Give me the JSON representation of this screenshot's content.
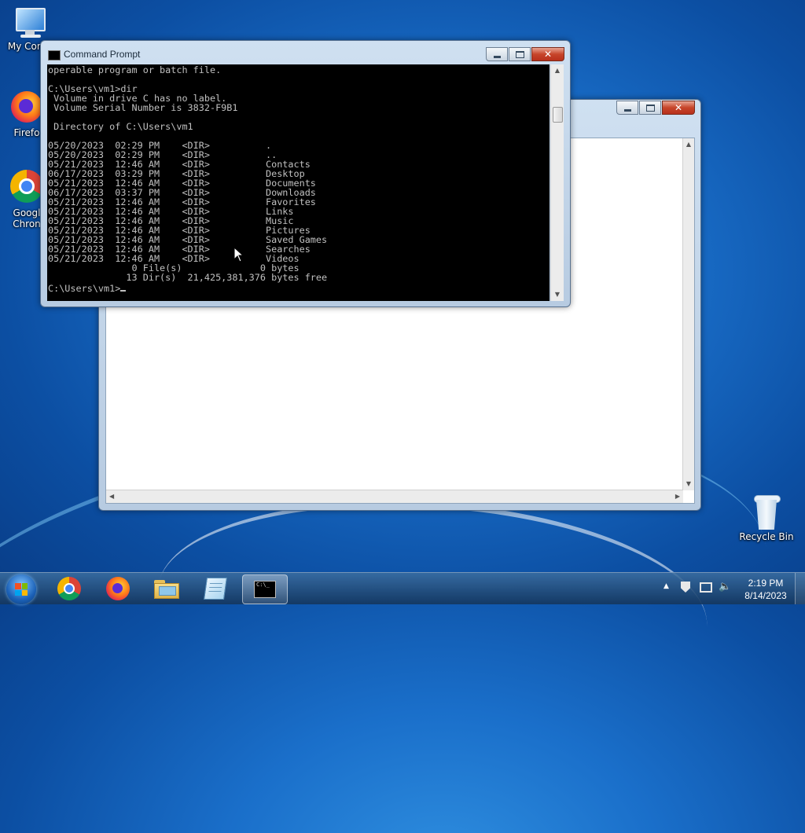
{
  "desktop": {
    "icons": [
      {
        "name": "computer",
        "label": "My Comp"
      },
      {
        "name": "firefox",
        "label": "Firefo"
      },
      {
        "name": "chrome",
        "label": "Googl\nChron"
      },
      {
        "name": "recycle-bin",
        "label": "Recycle Bin"
      }
    ]
  },
  "cmd": {
    "title": "Command Prompt",
    "output": "operable program or batch file.\n\nC:\\Users\\vm1>dir\n Volume in drive C has no label.\n Volume Serial Number is 3832-F9B1\n\n Directory of C:\\Users\\vm1\n\n05/20/2023  02:29 PM    <DIR>          .\n05/20/2023  02:29 PM    <DIR>          ..\n05/21/2023  12:46 AM    <DIR>          Contacts\n06/17/2023  03:29 PM    <DIR>          Desktop\n05/21/2023  12:46 AM    <DIR>          Documents\n06/17/2023  03:37 PM    <DIR>          Downloads\n05/21/2023  12:46 AM    <DIR>          Favorites\n05/21/2023  12:46 AM    <DIR>          Links\n05/21/2023  12:46 AM    <DIR>          Music\n05/21/2023  12:46 AM    <DIR>          Pictures\n05/21/2023  12:46 AM    <DIR>          Saved Games\n05/21/2023  12:46 AM    <DIR>          Searches\n05/21/2023  12:46 AM    <DIR>          Videos\n               0 File(s)              0 bytes\n              13 Dir(s)  21,425,381,376 bytes free\n",
    "prompt": "C:\\Users\\vm1>"
  },
  "clock": {
    "time": "2:19 PM",
    "date": "8/14/2023"
  },
  "taskbar": {
    "items": [
      "start",
      "chrome",
      "firefox",
      "explorer",
      "notepad",
      "command-prompt"
    ]
  },
  "colors": {
    "console_bg": "#000000",
    "console_text": "#c0c0c0",
    "close_red": "#c7452a"
  }
}
